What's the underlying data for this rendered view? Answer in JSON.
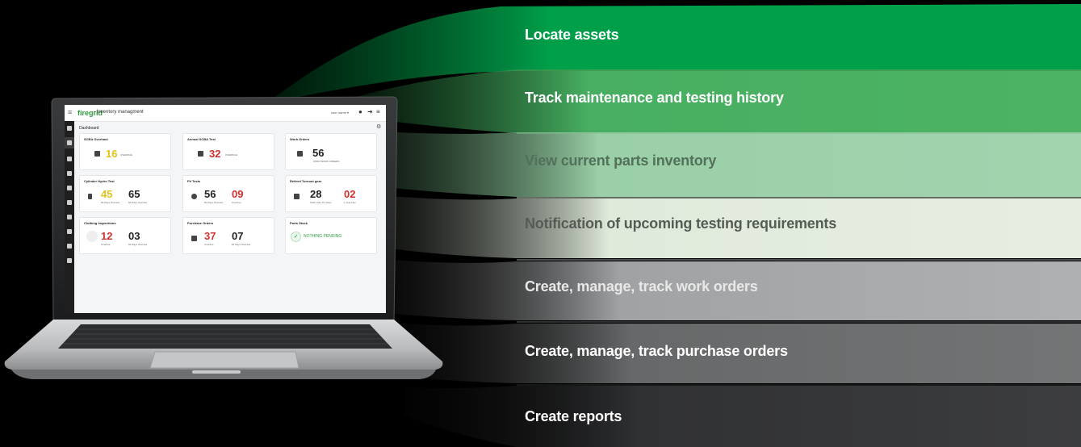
{
  "features": [
    {
      "label": "Locate assets",
      "color": "#00a04a",
      "text_color": "#ffffff"
    },
    {
      "label": "Track maintenance and testing history",
      "color": "#45ad5f",
      "text_color": "#ffffff"
    },
    {
      "label": "View current parts inventory",
      "color": "#9bd0a8",
      "text_color": "#4f6a55"
    },
    {
      "label": "Notification of upcoming testing requirements",
      "color": "#e2ecdd",
      "text_color": "#555c55"
    },
    {
      "label": "Create, manage, track work orders",
      "color": "#a6a8aa",
      "text_color": "#e6e6e6"
    },
    {
      "label": "Create, manage, track purchase orders",
      "color": "#6b6d6f",
      "text_color": "#ffffff"
    },
    {
      "label": "Create reports",
      "color": "#333436",
      "text_color": "#ffffff"
    }
  ],
  "app": {
    "logo": "firegrid",
    "title": "- Inventory managment",
    "user": "user name ▾",
    "page_title": "Dashboard"
  },
  "cards": [
    {
      "title": "SCBA Overhaul",
      "value": "16",
      "value_color": "#e3c316",
      "label": "OVERDUE"
    },
    {
      "title": "Annual SCBA Test",
      "value": "32",
      "value_color": "#d32f2f",
      "label": "OVERDUE"
    },
    {
      "title": "Work Orders",
      "value": "56",
      "value_color": "#222222",
      "label": "OPEN WORK ORDERS"
    },
    {
      "title": "Cylinder Hydro Test",
      "value": "45",
      "value_color": "#e3c316",
      "label": "90 Days Overdue",
      "value2": "65",
      "value2_color": "#222222",
      "label2": "60 Days Overdue"
    },
    {
      "title": "Fit Tests",
      "value": "56",
      "value_color": "#222222",
      "label": "60 Days Overdue",
      "value2": "09",
      "value2_color": "#d32f2f",
      "label2": "Overdue"
    },
    {
      "title": "Retired Turnout gear",
      "value": "28",
      "value_color": "#222222",
      "label": "Older than 10 Years",
      "value2": "02",
      "value2_color": "#d32f2f",
      "label2": "1 Year Due"
    },
    {
      "title": "Clothing Inspections",
      "value": "12",
      "value_color": "#d32f2f",
      "label": "Overdue",
      "value2": "03",
      "value2_color": "#222222",
      "label2": "60 Days Overdue"
    },
    {
      "title": "Purchase Orders",
      "value": "37",
      "value_color": "#d32f2f",
      "label": "Overdue",
      "value2": "07",
      "value2_color": "#222222",
      "label2": "60 Days Overdue"
    },
    {
      "title": "Parts Stock",
      "status": "NOTHING PENDING"
    }
  ]
}
